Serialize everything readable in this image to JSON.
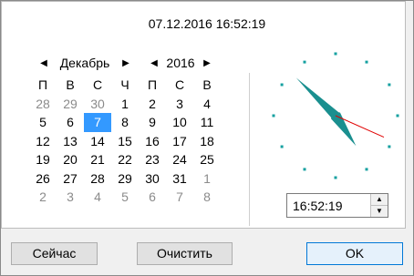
{
  "header": {
    "datetime": "07.12.2016 16:52:19"
  },
  "calendar": {
    "month": "Декабрь",
    "year": "2016",
    "weekdays": [
      "П",
      "В",
      "С",
      "Ч",
      "П",
      "С",
      "В"
    ],
    "weeks": [
      [
        "28",
        "29",
        "30",
        "1",
        "2",
        "3",
        "4"
      ],
      [
        "5",
        "6",
        "7",
        "8",
        "9",
        "10",
        "11"
      ],
      [
        "12",
        "13",
        "14",
        "15",
        "16",
        "17",
        "18"
      ],
      [
        "19",
        "20",
        "21",
        "22",
        "23",
        "24",
        "25"
      ],
      [
        "26",
        "27",
        "28",
        "29",
        "30",
        "31",
        "1"
      ],
      [
        "2",
        "3",
        "4",
        "5",
        "6",
        "7",
        "8"
      ]
    ],
    "selected_day": "7"
  },
  "time": {
    "value": "16:52:19",
    "hour": 16,
    "minute": 52,
    "second": 19
  },
  "colors": {
    "selected": "#3399ff",
    "hand": "#1a8f8f",
    "second_hand": "#e00000",
    "tick": "#14a0a0"
  },
  "buttons": {
    "now": "Сейчас",
    "clear": "Очистить",
    "ok": "OK"
  }
}
